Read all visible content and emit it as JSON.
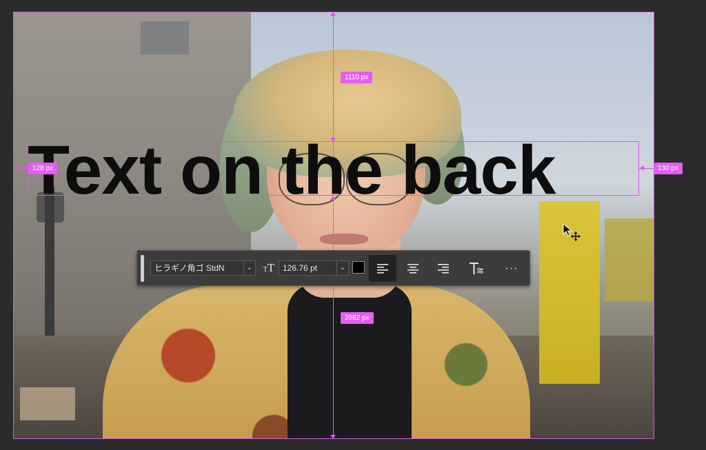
{
  "canvas": {
    "headline": "Text on the back"
  },
  "measurements": {
    "top_distance": "1110 px",
    "bottom_distance": "2082 px",
    "left_distance": "128 px",
    "right_distance": "130 px"
  },
  "toolbar": {
    "font_family": "ヒラギノ角ゴ StdN",
    "font_size": "126.76 pt",
    "text_color": "#000000",
    "alignment_selected": "left",
    "icons": {
      "font_size_icon": "text-size-icon",
      "align_left": "align-left-icon",
      "align_center": "align-center-icon",
      "align_right": "align-right-icon",
      "text_options": "text-settings-icon",
      "more": "more-icon"
    },
    "more_label": "···"
  },
  "colors": {
    "guide": "#d65ae6",
    "measure_badge": "#e55ef0",
    "toolbar_bg": "#3c3c3c",
    "workspace_bg": "#2b2b2b"
  },
  "cursor": {
    "icon": "move-cursor-icon"
  }
}
